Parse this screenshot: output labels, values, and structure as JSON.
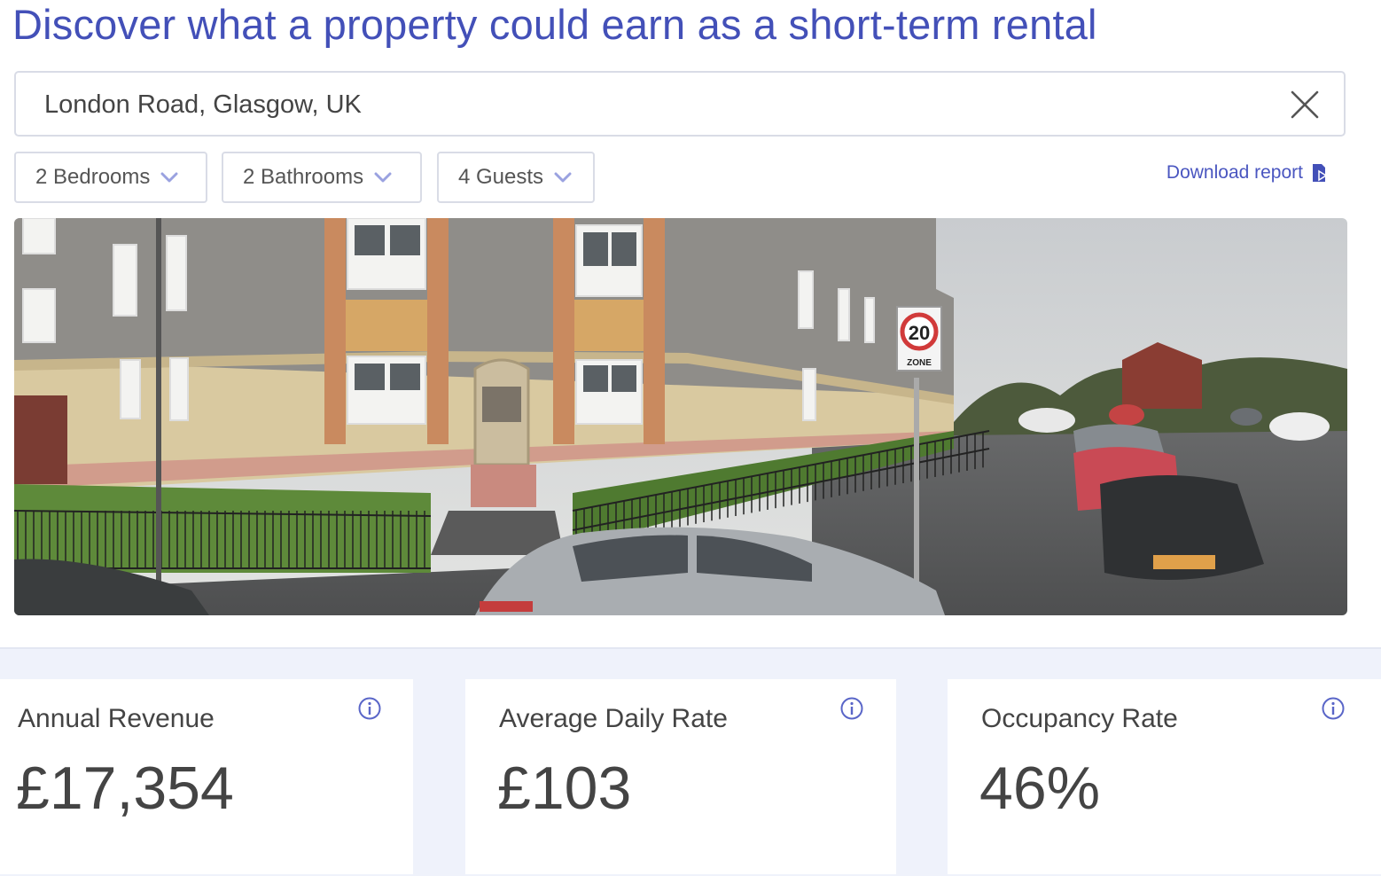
{
  "page": {
    "title": "Discover what a property could earn as a short-term rental"
  },
  "search": {
    "value": "London Road, Glasgow, UK",
    "clear_icon": "close-icon"
  },
  "filters": {
    "bedrooms": "2 Bedrooms",
    "bathrooms": "2 Bathrooms",
    "guests": "4 Guests"
  },
  "download": {
    "label": "Download report",
    "icon": "document-download-icon"
  },
  "photo": {
    "sign_number": "20",
    "sign_text": "ZONE"
  },
  "stats": [
    {
      "label": "Annual Revenue",
      "value": "£17,354"
    },
    {
      "label": "Average Daily Rate",
      "value": "£103"
    },
    {
      "label": "Occupancy Rate",
      "value": "46%"
    }
  ],
  "colors": {
    "accent": "#4350b8",
    "border": "#d9dce6",
    "band": "#eff2fb"
  }
}
